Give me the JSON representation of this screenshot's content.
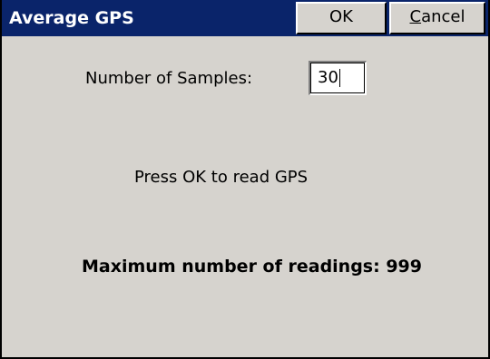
{
  "dialog": {
    "title": "Average GPS",
    "ok_label": "OK",
    "cancel_label": "Cancel"
  },
  "samples": {
    "label": "Number of Samples:",
    "value": "30"
  },
  "instruction": "Press OK to read GPS",
  "max_readings": "Maximum number of readings: 999",
  "colors": {
    "titlebar": "#0a246a",
    "title_text": "#ffffff",
    "dialog_background": "#d6d3ce"
  }
}
